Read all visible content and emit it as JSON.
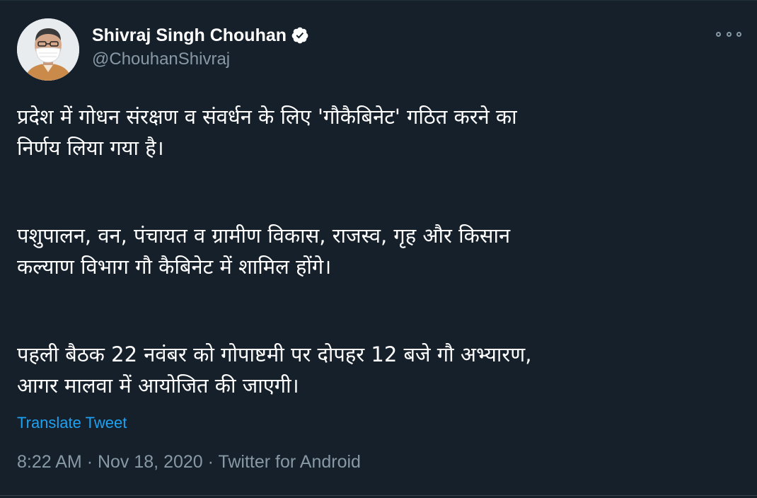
{
  "author": {
    "name": "Shivraj Singh Chouhan",
    "handle": "@ChouhanShivraj",
    "verified_icon": "verified-badge-icon"
  },
  "menu": {
    "icon": "more-icon"
  },
  "tweet": {
    "paragraphs": [
      {
        "line1": "प्रदेश में गोधन संरक्षण व संवर्धन के लिए 'गौकैबिनेट' गठित करने का",
        "line2": "निर्णय लिया गया है।"
      },
      {
        "line1": "पशुपालन, वन, पंचायत व ग्रामीण विकास, राजस्व, गृह और किसान",
        "line2": "कल्याण विभाग गौ कैबिनेट में शामिल होंगे।"
      },
      {
        "line1": "पहली बैठक 22 नवंबर को गोपाष्टमी पर दोपहर 12 बजे गौ अभ्यारण,",
        "line2": "आगर मालवा में आयोजित की जाएगी।"
      }
    ],
    "translate_label": "Translate Tweet",
    "time": "8:22 AM",
    "date": "Nov 18, 2020",
    "source": "Twitter for Android",
    "separator": "·"
  },
  "colors": {
    "background": "#15202b",
    "primary_text": "#ffffff",
    "secondary_text": "#8899a6",
    "link": "#1da1f2"
  }
}
